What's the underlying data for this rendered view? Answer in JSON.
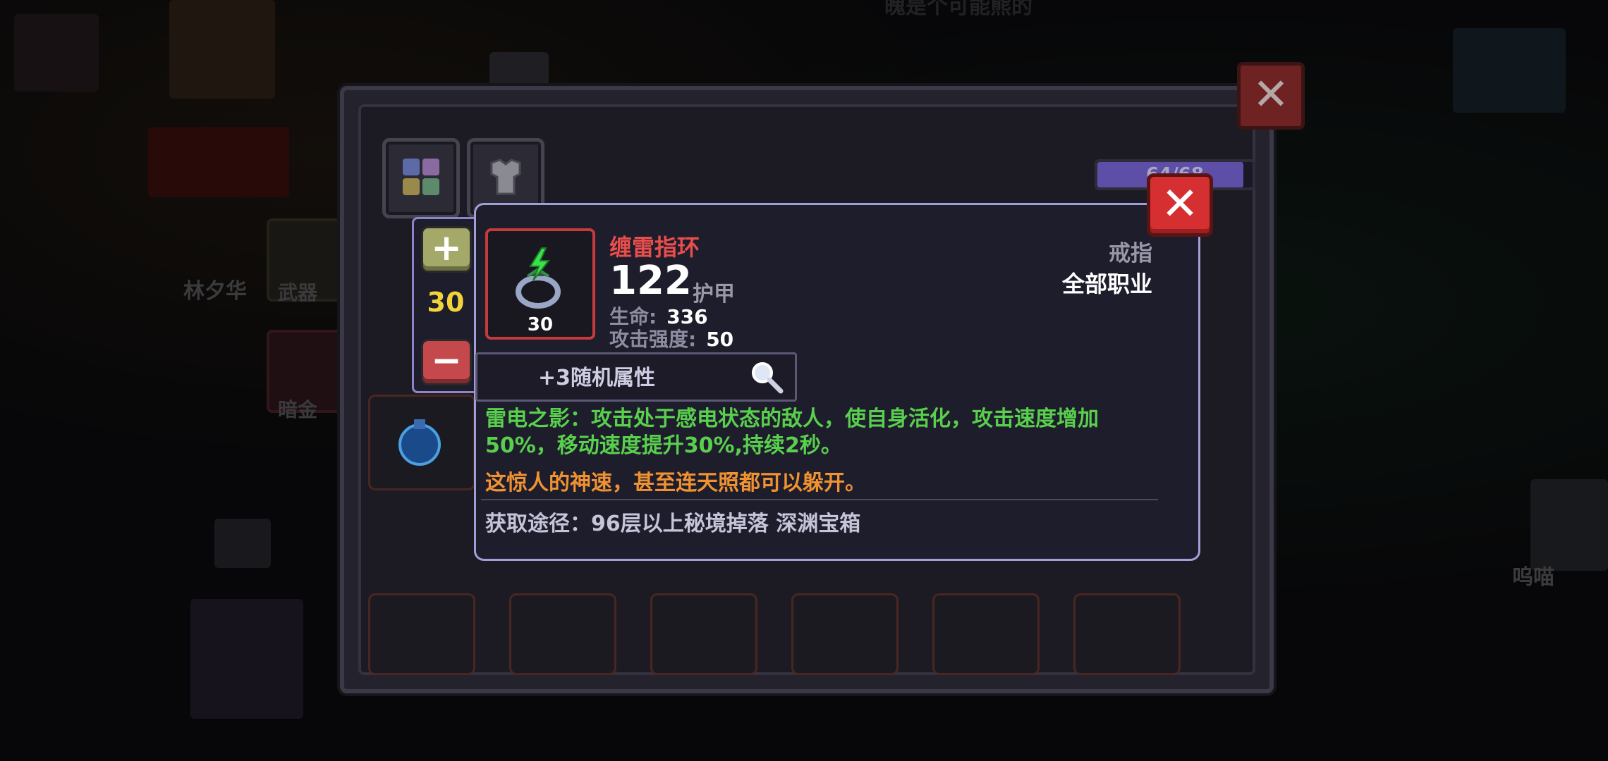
{
  "background": {
    "top_text": "魄是个可能熊的",
    "characters": [
      {
        "name": "林夕华"
      },
      {
        "name": "呜喵"
      }
    ],
    "side_buttons": [
      {
        "label": "武器"
      },
      {
        "label": "暗金"
      }
    ]
  },
  "inventory": {
    "capacity_text": "64/68",
    "capacity_fraction": 0.94,
    "close_symbol": "✕"
  },
  "stepper": {
    "plus_symbol": "+",
    "minus_symbol": "−",
    "value": "30"
  },
  "item": {
    "name": "缠雷指环",
    "level": "30",
    "armor_value": "122",
    "armor_label": "护甲",
    "stats": [
      {
        "key": "生命:",
        "value": "336"
      },
      {
        "key": "攻击强度:",
        "value": "50"
      }
    ],
    "type": "戒指",
    "class": "全部职业",
    "random_attrs": "+3随机属性",
    "description": "雷电之影：攻击处于感电状态的敌人，使自身活化，攻击速度增加50%，移动速度提升30%,持续2秒。",
    "flavor": "这惊人的神速，甚至连天照都可以躲开。",
    "source": "获取途径：96层以上秘境掉落 深渊宝箱",
    "close_symbol": "✕"
  },
  "colors": {
    "name_red": "#e94e4c",
    "desc_green": "#59d04d",
    "flavor_orange": "#f09232",
    "stepper_value_yellow": "#f2d33a"
  }
}
